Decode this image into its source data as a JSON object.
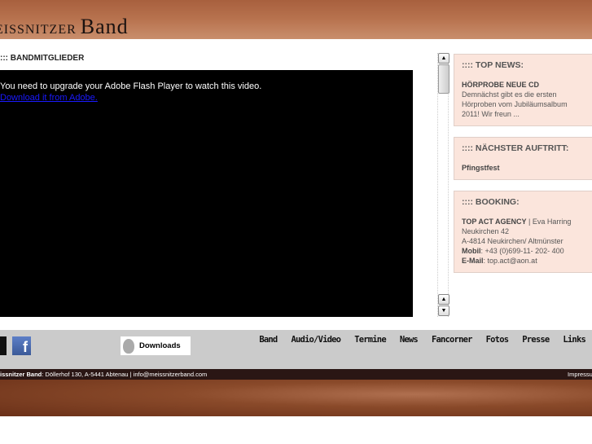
{
  "header": {
    "logo": "Meissnitzer Band",
    "logo_visible_small": "EISSNITZER",
    "logo_visible_big": "Band"
  },
  "main": {
    "title": "::: BANDMITGLIEDER",
    "flash_message": "You need to upgrade your Adobe Flash Player to watch this video.",
    "flash_link": "Download it from Adobe."
  },
  "sidebar": {
    "news": {
      "title": ":::: TOP NEWS:",
      "headline": "HÖRPROBE NEUE CD",
      "text": "Demnächst gibt es die ersten Hörproben vom Jubiläumsalbum 2011! Wir freun ..."
    },
    "gig": {
      "title": ":::: NÄCHSTER AUFTRITT:",
      "event": "Pfingstfest"
    },
    "booking": {
      "title": ":::: BOOKING:",
      "agency": "TOP ACT AGENCY",
      "contact": " | Eva Harring",
      "street": "Neukirchen 42",
      "city": "A-4814 Neukirchen/ Altmünster",
      "mobil_label": "Mobil",
      "mobil": ": +43 (0)699-11- 202- 400",
      "email_label": "E-Mail",
      "email": ": top.act@aon.at"
    }
  },
  "nav": {
    "downloads": "Downloads",
    "links": [
      "Band",
      "Audio/Video",
      "Termine",
      "News",
      "Fancorner",
      "Fotos",
      "Presse",
      "Links"
    ]
  },
  "footer": {
    "name": "issnitzer Band",
    "address": ": Döllerhof 130, A-5441 Abtenau | info@meissnitzerband.com",
    "impressum": "Impressum"
  }
}
